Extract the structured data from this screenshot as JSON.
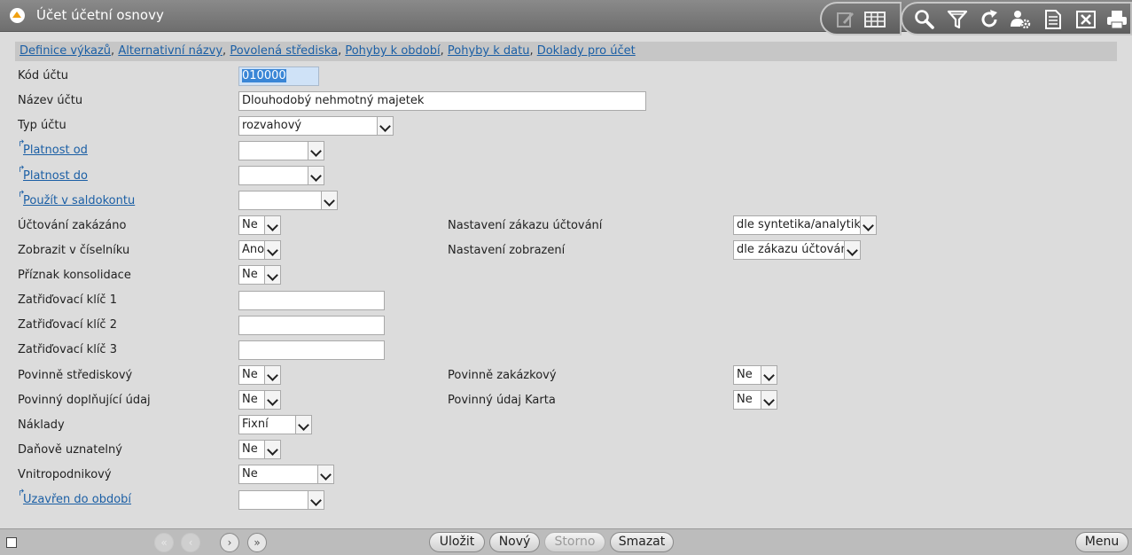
{
  "window": {
    "title": "Účet účetní osnovy"
  },
  "links": [
    "Definice výkazů",
    "Alternativní názvy",
    "Povolená střediska",
    "Pohyby k období",
    "Pohyby k datu",
    "Doklady pro účet"
  ],
  "form": {
    "kod_uctu": {
      "label": "Kód účtu",
      "value": "010000"
    },
    "nazev_uctu": {
      "label": "Název účtu",
      "value": "Dlouhodobý nehmotný majetek"
    },
    "typ_uctu": {
      "label": "Typ účtu",
      "value": "rozvahový"
    },
    "platnost_od": {
      "label": "Platnost od",
      "value": ""
    },
    "platnost_do": {
      "label": "Platnost do",
      "value": ""
    },
    "pouzit_saldokonto": {
      "label": "Použít v saldokontu",
      "value": ""
    },
    "uctovani_zakazano": {
      "label": "Účtování zakázáno",
      "value": "Ne"
    },
    "nastaveni_zakazu": {
      "label": "Nastavení zákazu účtování",
      "value": "dle syntetika/analytika"
    },
    "zobrazit_ciselnik": {
      "label": "Zobrazit v číselníku",
      "value": "Ano"
    },
    "nastaveni_zobrazeni": {
      "label": "Nastavení zobrazení",
      "value": "dle zákazu účtování"
    },
    "priznak_konsolidace": {
      "label": "Příznak konsolidace",
      "value": "Ne"
    },
    "zatr_klic_1": {
      "label": "Zatřiďovací klíč 1",
      "value": ""
    },
    "zatr_klic_2": {
      "label": "Zatřiďovací klíč 2",
      "value": ""
    },
    "zatr_klic_3": {
      "label": "Zatřiďovací klíč 3",
      "value": ""
    },
    "povinne_strediskovy": {
      "label": "Povinně střediskový",
      "value": "Ne"
    },
    "povinne_zakazkovy": {
      "label": "Povinně zakázkový",
      "value": "Ne"
    },
    "povinny_doplnujici": {
      "label": "Povinný doplňující údaj",
      "value": "Ne"
    },
    "povinny_karta": {
      "label": "Povinný údaj Karta",
      "value": "Ne"
    },
    "naklady": {
      "label": "Náklady",
      "value": "Fixní"
    },
    "danove_uznatelny": {
      "label": "Daňově uznatelný",
      "value": "Ne"
    },
    "vnitropodnikovy": {
      "label": "Vnitropodnikový",
      "value": "Ne"
    },
    "uzavren_obdobi": {
      "label": "Uzavřen do období",
      "value": ""
    }
  },
  "buttons": {
    "save": "Uložit",
    "new": "Nový",
    "cancel": "Storno",
    "delete": "Smazat",
    "menu": "Menu"
  },
  "nav_glyphs": {
    "first": "«",
    "prev": "‹",
    "next": "›",
    "last": "»"
  },
  "icons": [
    "edit-icon",
    "table-icon",
    "search-icon",
    "filter-icon",
    "refresh-icon",
    "user-settings-icon",
    "document-icon",
    "excel-icon",
    "print-icon"
  ]
}
